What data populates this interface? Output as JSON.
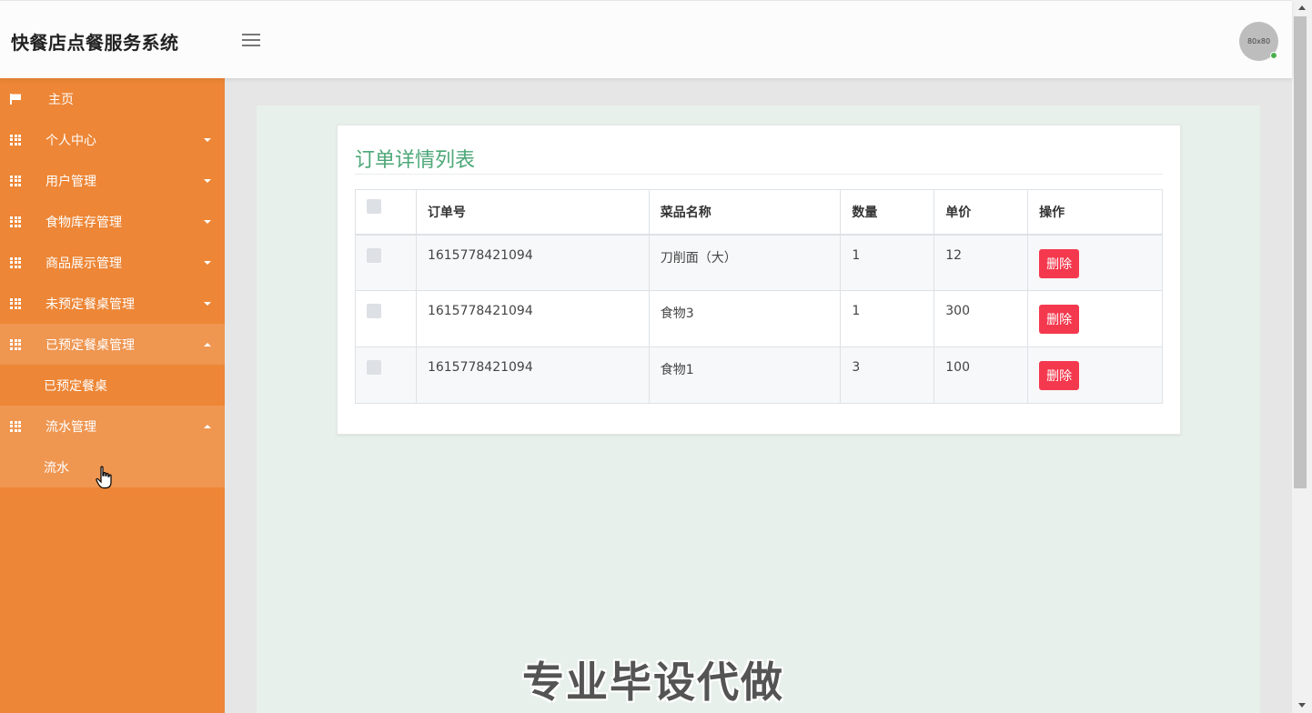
{
  "header": {
    "app_title": "快餐店点餐服务系统",
    "avatar_text": "80x80"
  },
  "sidebar": {
    "items": [
      {
        "label": "主页",
        "icon": "flag-icon"
      },
      {
        "label": "个人中心",
        "icon": "grid-icon"
      },
      {
        "label": "用户管理",
        "icon": "grid-icon"
      },
      {
        "label": "食物库存管理",
        "icon": "grid-icon"
      },
      {
        "label": "商品展示管理",
        "icon": "grid-icon"
      },
      {
        "label": "未预定餐桌管理",
        "icon": "grid-icon"
      },
      {
        "label": "已预定餐桌管理",
        "icon": "grid-icon",
        "sub": "已预定餐桌"
      },
      {
        "label": "流水管理",
        "icon": "grid-icon",
        "sub": "流水"
      }
    ]
  },
  "main": {
    "title": "订单详情列表",
    "table": {
      "headers": [
        "订单号",
        "菜品名称",
        "数量",
        "单价",
        "操作"
      ],
      "rows": [
        {
          "order_no": "1615778421094",
          "dish": "刀削面（大）",
          "qty": "1",
          "price": "12",
          "action": "删除"
        },
        {
          "order_no": "1615778421094",
          "dish": "食物3",
          "qty": "1",
          "price": "300",
          "action": "删除"
        },
        {
          "order_no": "1615778421094",
          "dish": "食物1",
          "qty": "3",
          "price": "100",
          "action": "删除"
        }
      ]
    }
  },
  "watermark": "专业毕设代做",
  "colors": {
    "sidebar": "#ed8636",
    "sidebar_active": "#ef9651",
    "title_green": "#4ca777",
    "delete_red": "#f4394e"
  }
}
